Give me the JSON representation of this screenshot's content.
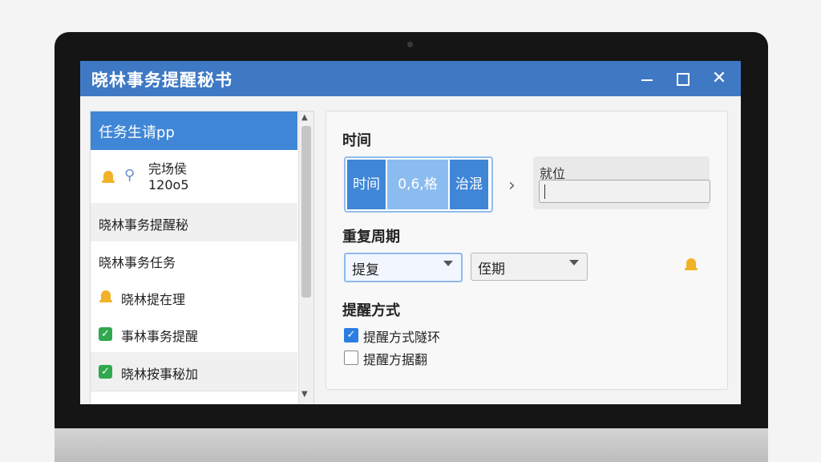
{
  "window": {
    "title": "晓林事务提醒秘书",
    "buttons": {
      "close": "✕"
    }
  },
  "sidebar": {
    "items": [
      {
        "label": "任务生请pp",
        "selected": true
      },
      {
        "label_line1": "完场侯",
        "label_line2": "120o5",
        "icon": "bell-icon",
        "secondary_icon": "pin-icon"
      },
      {
        "label": "晓林事务提醒秘"
      },
      {
        "label": "晓林事务任务"
      },
      {
        "label": "晓林提在理",
        "icon": "bell-icon"
      },
      {
        "label": "事林事务提醒",
        "icon": "check-icon"
      },
      {
        "label": "晓林按事秘加",
        "icon": "check-icon"
      }
    ],
    "scroll": {
      "up": "▲",
      "down": "▼"
    }
  },
  "main": {
    "time_section": {
      "title": "时间",
      "segments": [
        "时间",
        "0,6,格",
        "治混"
      ],
      "input_label": "就位",
      "input_value": ""
    },
    "repeat_section": {
      "title": "重复周期",
      "dropdown1": "提复",
      "dropdown2": "侄期"
    },
    "reminder_section": {
      "title": "提醒方式",
      "options": [
        {
          "label": "提醒方式隧环",
          "checked": true
        },
        {
          "label": "提醒方据翻",
          "checked": false
        }
      ]
    }
  },
  "colors": {
    "title_bar": "#3f79c4",
    "selected_item": "#3f86d6",
    "accent": "#2d7de0",
    "bell": "#f2b227",
    "check": "#2fa84f"
  }
}
